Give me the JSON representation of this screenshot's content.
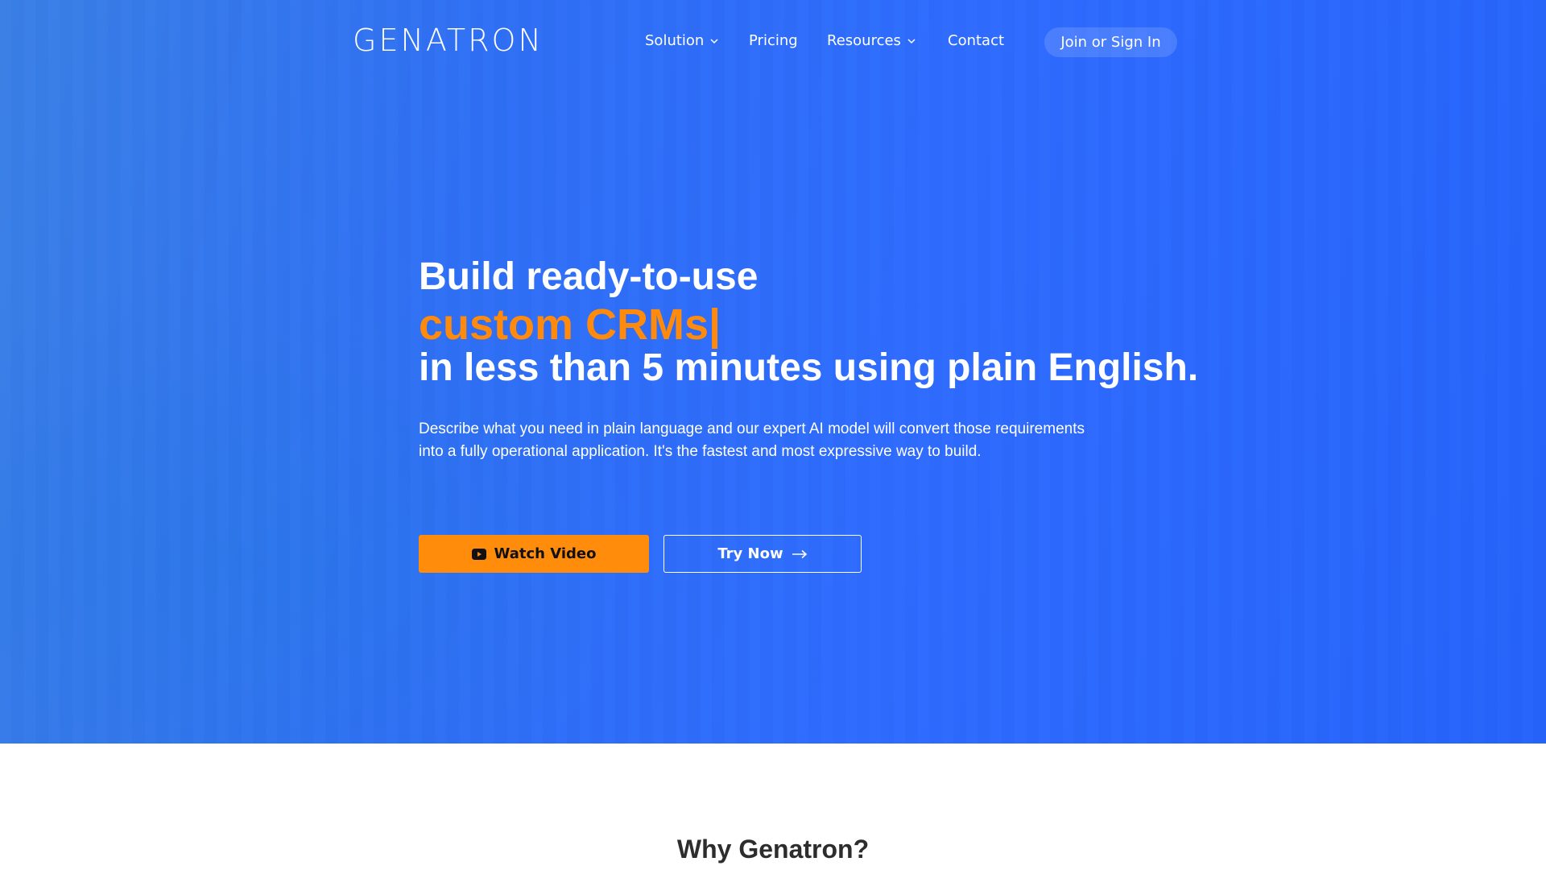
{
  "brand": {
    "logo_text": "GENATRON"
  },
  "nav": {
    "items": [
      {
        "label": "Solution",
        "has_dropdown": true
      },
      {
        "label": "Pricing",
        "has_dropdown": false
      },
      {
        "label": "Resources",
        "has_dropdown": true
      },
      {
        "label": "Contact",
        "has_dropdown": false
      }
    ],
    "signin_label": "Join or Sign In"
  },
  "hero": {
    "headline_line1": "Build ready-to-use",
    "headline_line2": "custom CRMs|",
    "headline_line3": "in less than 5 minutes using plain English.",
    "description": "Describe what you need in plain language and our expert AI model will convert those requirements into a fully operational application. It's the fastest and most expressive way to build.",
    "watch_video_label": "Watch Video",
    "try_now_label": "Try Now"
  },
  "section": {
    "why_title": "Why Genatron?"
  },
  "icons": {
    "play": "youtube-play-icon",
    "arrow": "arrow-right-icon",
    "chevron": "chevron-down-icon"
  },
  "colors": {
    "hero_blue": "#2f6ff5",
    "accent_orange": "#ff8c0a",
    "white": "#ffffff",
    "heading_dark": "#2d2d2d"
  }
}
